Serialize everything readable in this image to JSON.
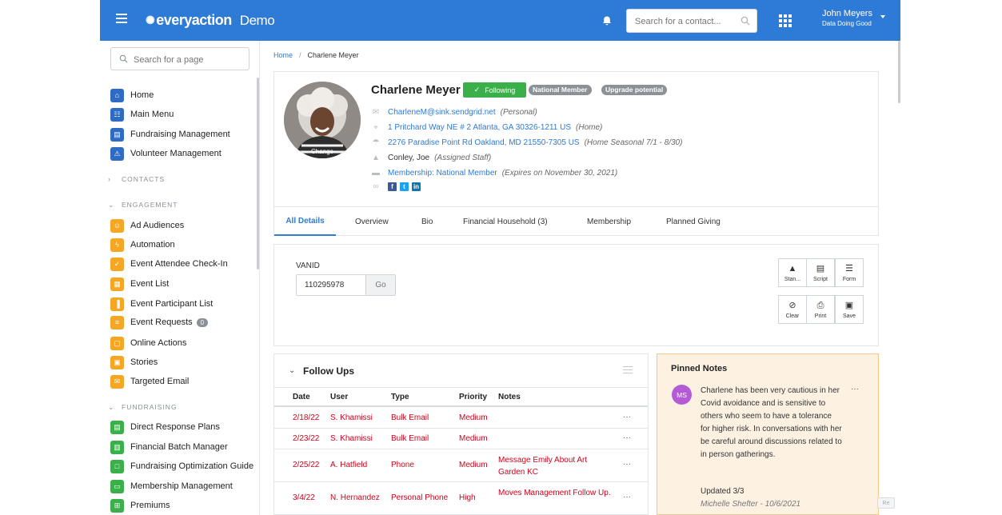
{
  "header": {
    "brand": "everyaction",
    "env": "Demo",
    "search_placeholder": "Search for a contact...",
    "user_name": "John Meyers",
    "user_org": "Data Doing Good",
    "icons": [
      "menu-icon",
      "bell-icon",
      "search-icon",
      "apps-grid-icon",
      "caret-down-icon"
    ]
  },
  "sidebar": {
    "search_placeholder": "Search for a page",
    "top_items": [
      {
        "label": "Home",
        "icon": "home-icon"
      },
      {
        "label": "Main Menu",
        "icon": "sitemap-icon"
      },
      {
        "label": "Fundraising Management",
        "icon": "money-icon"
      },
      {
        "label": "Volunteer Management",
        "icon": "volunteer-icon"
      }
    ],
    "sections": {
      "contacts": "CONTACTS",
      "engagement": "ENGAGEMENT",
      "fundraising": "FUNDRAISING"
    },
    "engagement_items": [
      {
        "label": "Ad Audiences"
      },
      {
        "label": "Automation"
      },
      {
        "label": "Event Attendee Check-In"
      },
      {
        "label": "Event List"
      },
      {
        "label": "Event Participant List"
      },
      {
        "label": "Event Requests",
        "badge": "0"
      },
      {
        "label": "Online Actions"
      },
      {
        "label": "Stories"
      },
      {
        "label": "Targeted Email"
      }
    ],
    "fundraising_items": [
      {
        "label": "Direct Response Plans"
      },
      {
        "label": "Financial Batch Manager"
      },
      {
        "label": "Fundraising Optimization Guide"
      },
      {
        "label": "Membership Management"
      },
      {
        "label": "Premiums"
      }
    ],
    "colors": {
      "blue": "#2d6bc4",
      "yellow": "#f5a623",
      "green": "#3bb04a"
    }
  },
  "breadcrumb": {
    "home": "Home",
    "separator": "/",
    "current": "Charlene Meyer"
  },
  "profile": {
    "name": "Charlene Meyer",
    "avatar_change": "Change",
    "following": "Following",
    "tags": [
      "National Member",
      "Upgrade potential"
    ],
    "email": "CharleneM@sink.sendgrid.net",
    "email_note": "(Personal)",
    "address1": "1 Pritchard Way NE # 2 Atlanta, GA 30326-1211 US",
    "address1_note": "(Home)",
    "address2": "2276 Paradise Point Rd Oakland, MD 21550-7305 US",
    "address2_note": "(Home Seasonal 7/1 - 8/30)",
    "staff": "Conley, Joe",
    "staff_note": "(Assigned Staff)",
    "membership": "Membership: National Member",
    "membership_note": "(Expires on November 30, 2021)",
    "social": [
      "f",
      "t",
      "in"
    ]
  },
  "tabs": [
    "All Details",
    "Overview",
    "Bio",
    "Financial Household (3)",
    "Membership",
    "Planned Giving"
  ],
  "vanid": {
    "label": "VANID",
    "value": "110295978",
    "go": "Go",
    "tools": [
      {
        "label": "Stan...",
        "icon": "person-icon"
      },
      {
        "label": "Script",
        "icon": "script-icon"
      },
      {
        "label": "Form",
        "icon": "list-icon"
      },
      {
        "label": "Clear",
        "icon": "ban-icon"
      },
      {
        "label": "Print",
        "icon": "print-icon"
      },
      {
        "label": "Save",
        "icon": "save-icon"
      }
    ]
  },
  "followups": {
    "title": "Follow Ups",
    "columns": [
      "Date",
      "User",
      "Type",
      "Priority",
      "Notes"
    ],
    "rows": [
      {
        "date": "2/18/22",
        "user": "S. Khamissi",
        "type": "Bulk Email",
        "priority": "Medium",
        "notes": ""
      },
      {
        "date": "2/23/22",
        "user": "S. Khamissi",
        "type": "Bulk Email",
        "priority": "Medium",
        "notes": ""
      },
      {
        "date": "2/25/22",
        "user": "A. Hatfield",
        "type": "Phone",
        "priority": "Medium",
        "notes": "Message Emily About Art Garden KC"
      },
      {
        "date": "3/4/22",
        "user": "N. Hernandez",
        "type": "Personal Phone",
        "priority": "High",
        "notes": "Moves Management Follow Up."
      }
    ],
    "row_action": "···",
    "text_color": "#d0021b"
  },
  "pinned": {
    "title": "Pinned Notes",
    "initials": "MS",
    "text": "Charlene has been very cautious in her Covid avoidance and is sensitive to others who seem to have a tolerance for higher risk. In conversations with her be careful around discussions related to in person gatherings.",
    "updated": "Updated 3/3",
    "author": "Michelle Shefter - 10/6/2021",
    "action": "···"
  },
  "corner": "Re"
}
